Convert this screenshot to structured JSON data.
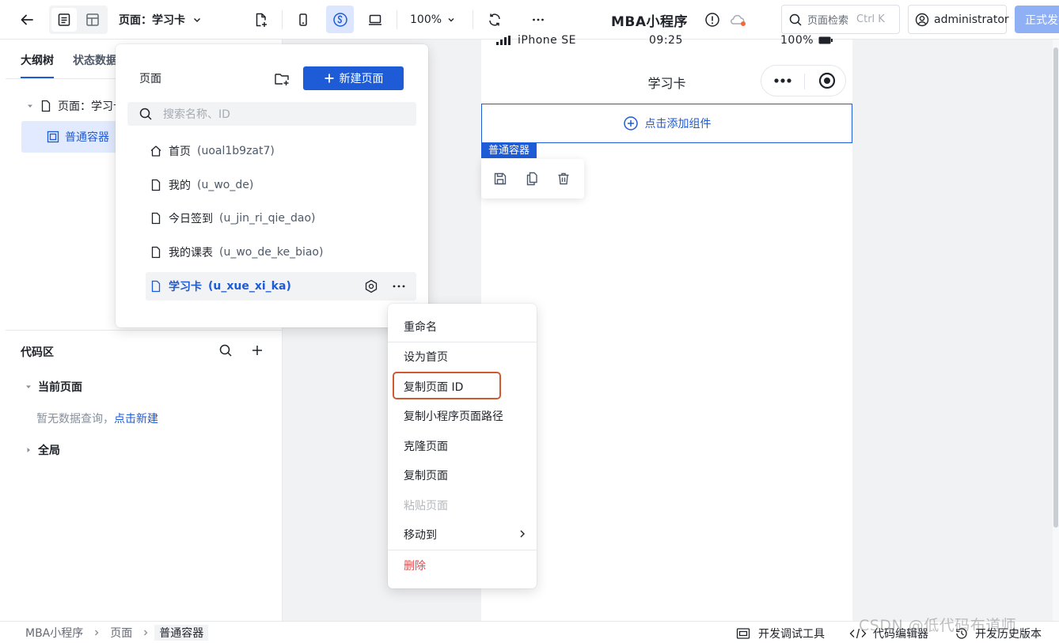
{
  "topbar": {
    "page_label": "页面：学习卡",
    "zoom": "100%",
    "app_title": "MBA小程序",
    "search_placeholder": "页面检索",
    "search_shortcut": "Ctrl K",
    "user": "administrator",
    "publish": "正式发布"
  },
  "left": {
    "tabs": [
      "大纲树",
      "状态数据"
    ],
    "tree_page": "页面：学习卡",
    "tree_container": "普通容器",
    "code_title": "代码区",
    "current_page": "当前页面",
    "empty_text": "暂无数据查询，",
    "create_link": "点击新建",
    "global": "全局"
  },
  "dropdown": {
    "title": "页面",
    "new_page": "新建页面",
    "search_placeholder": "搜索名称、ID",
    "pages": [
      {
        "name": "首页",
        "id": "(uoal1b9zat7)"
      },
      {
        "name": "我的",
        "id": "(u_wo_de)"
      },
      {
        "name": "今日签到",
        "id": "(u_jin_ri_qie_dao)"
      },
      {
        "name": "我的课表",
        "id": "(u_wo_de_ke_biao)"
      },
      {
        "name": "学习卡",
        "id": "(u_xue_xi_ka)"
      }
    ]
  },
  "phone": {
    "carrier": "iPhone SE",
    "time": "09:25",
    "battery": "100%",
    "page_title": "学习卡",
    "add_component": "点击添加组件",
    "container_tag": "普通容器"
  },
  "context_menu": {
    "items": [
      "重命名",
      "设为首页",
      "复制页面 ID",
      "复制小程序页面路径",
      "克隆页面",
      "复制页面",
      "粘贴页面",
      "移动到",
      "删除"
    ]
  },
  "bottombar": {
    "breadcrumb": [
      "MBA小程序",
      "页面",
      "普通容器"
    ],
    "devtools": "开发调试工具",
    "code_editor": "代码编辑器",
    "history": "开发历史版本"
  },
  "watermark": "CSDN @低代码布道师",
  "colors": {
    "accent": "#1e5bd6",
    "selected_bg": "#e1eaff",
    "danger": "#e5484d",
    "highlight_border": "#d0592e"
  }
}
